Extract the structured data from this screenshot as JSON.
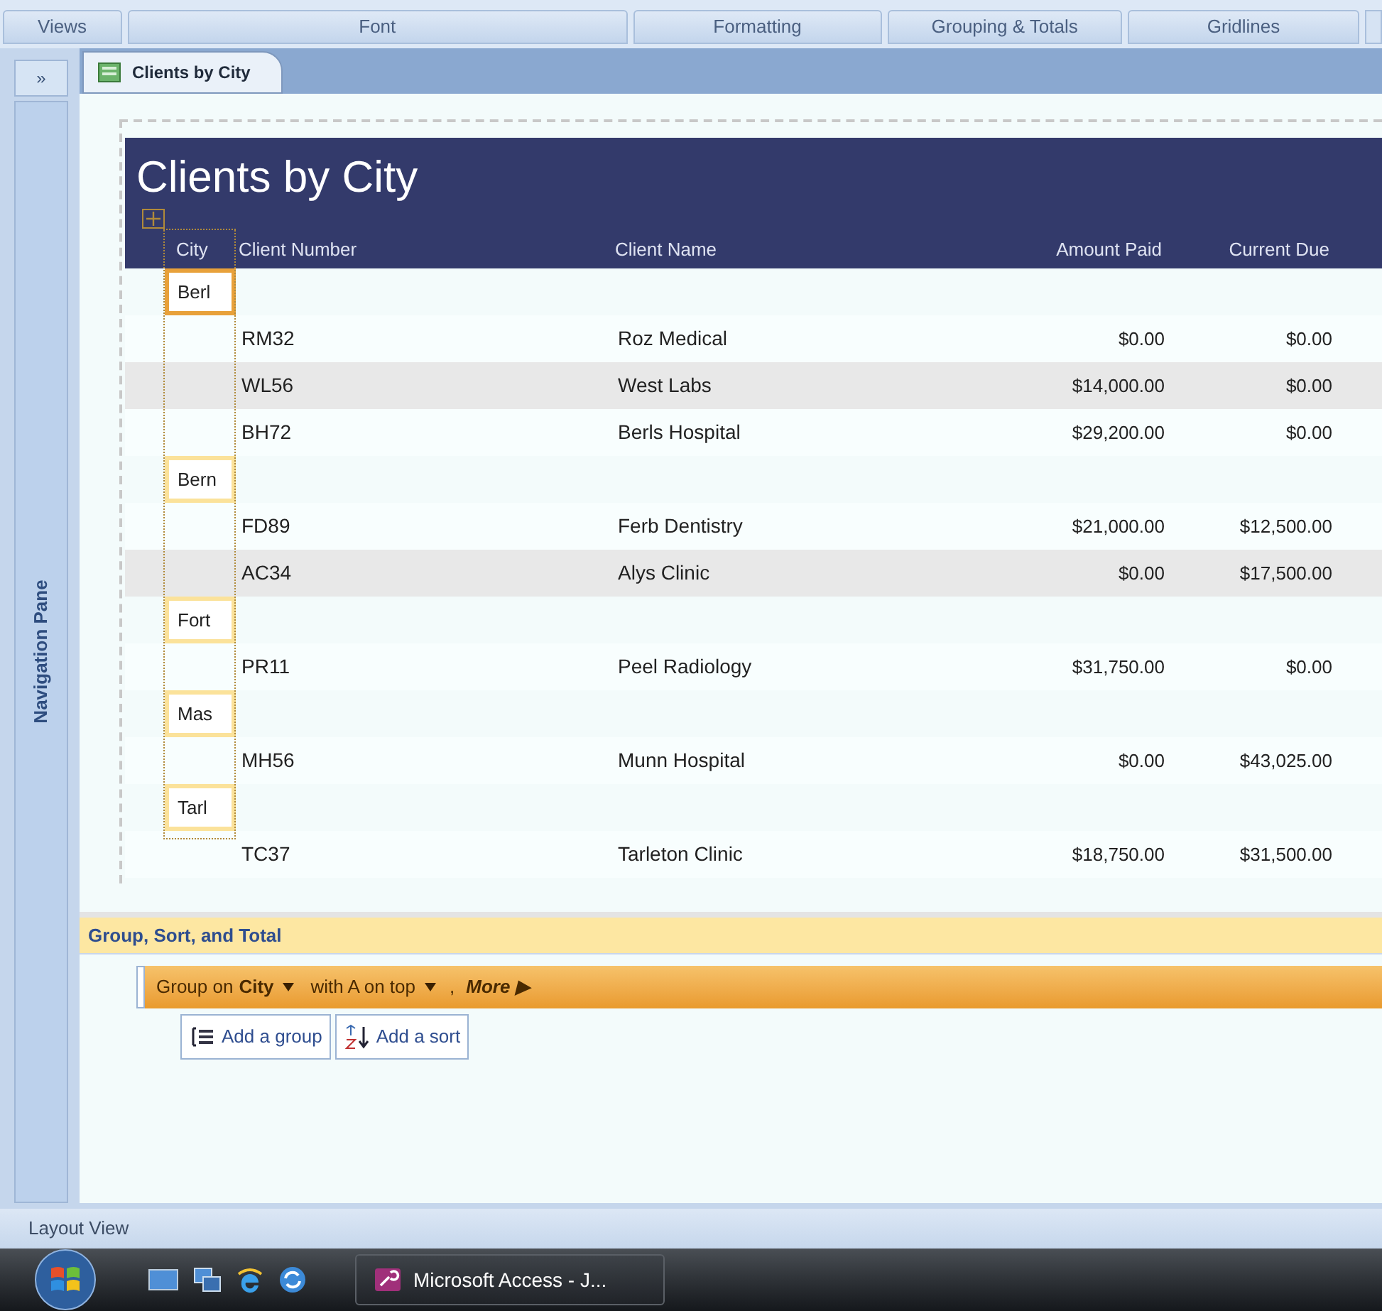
{
  "ribbon_groups": [
    "Views",
    "Font",
    "Formatting",
    "Grouping & Totals",
    "Gridlines"
  ],
  "navigation_pane": {
    "toggle": "»",
    "label": "Navigation Pane"
  },
  "document_tab": {
    "label": "Clients by City",
    "selected": true
  },
  "report": {
    "title": "Clients by City",
    "columns": [
      "City",
      "Client Number",
      "Client Name",
      "Amount Paid",
      "Current Due"
    ],
    "groups": [
      {
        "city": "Berl",
        "selected": true,
        "rows": [
          {
            "number": "RM32",
            "name": "Roz Medical",
            "paid": "$0.00",
            "due": "$0.00",
            "shaded": false
          },
          {
            "number": "WL56",
            "name": "West Labs",
            "paid": "$14,000.00",
            "due": "$0.00",
            "shaded": true
          },
          {
            "number": "BH72",
            "name": "Berls Hospital",
            "paid": "$29,200.00",
            "due": "$0.00",
            "shaded": false
          }
        ]
      },
      {
        "city": "Bern",
        "selected": false,
        "rows": [
          {
            "number": "FD89",
            "name": "Ferb Dentistry",
            "paid": "$21,000.00",
            "due": "$12,500.00",
            "shaded": false
          },
          {
            "number": "AC34",
            "name": "Alys Clinic",
            "paid": "$0.00",
            "due": "$17,500.00",
            "shaded": true
          }
        ]
      },
      {
        "city": "Fort",
        "selected": false,
        "rows": [
          {
            "number": "PR11",
            "name": "Peel Radiology",
            "paid": "$31,750.00",
            "due": "$0.00",
            "shaded": false
          }
        ]
      },
      {
        "city": "Mas",
        "selected": false,
        "rows": [
          {
            "number": "MH56",
            "name": "Munn Hospital",
            "paid": "$0.00",
            "due": "$43,025.00",
            "shaded": false
          }
        ]
      },
      {
        "city": "Tarl",
        "selected": false,
        "rows": [
          {
            "number": "TC37",
            "name": "Tarleton Clinic",
            "paid": "$18,750.00",
            "due": "$31,500.00",
            "shaded": false
          }
        ]
      }
    ]
  },
  "group_sort_total": {
    "title": "Group, Sort, and Total",
    "group_bar": {
      "prefix": "Group on",
      "field": "City",
      "order": "with A on top",
      "separator": ",",
      "more": "More",
      "more_arrow": "▶"
    },
    "buttons": [
      "Add a group",
      "Add a sort"
    ]
  },
  "status_bar": {
    "text": "Layout View"
  },
  "taskbar": {
    "task": "Microsoft Access - J..."
  }
}
